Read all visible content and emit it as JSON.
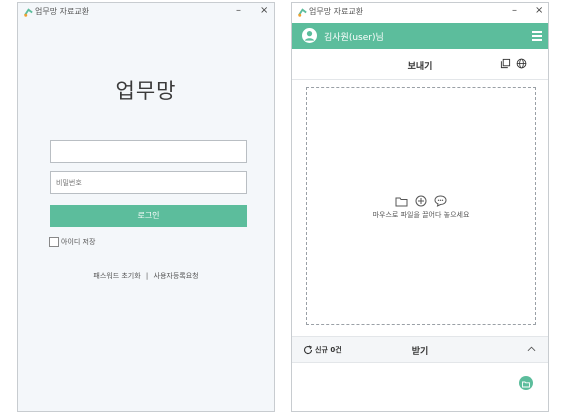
{
  "login_window": {
    "title": "업무망 자료교환",
    "min_glyph": "–",
    "close_glyph": "×",
    "app_name": "업무망",
    "id_input": {
      "value": "",
      "placeholder": ""
    },
    "password_input": {
      "value": "",
      "placeholder": "비밀번호"
    },
    "login_label": "로그인",
    "remember_label": "아이디 저장",
    "remember_checked": false,
    "reset_password_link": "패스워드 초기화",
    "link_separator": "|",
    "register_link": "사용자등록요청"
  },
  "main_window": {
    "title": "업무망 자료교환",
    "min_glyph": "–",
    "close_glyph": "×",
    "user_label": "김사원(user)님",
    "send_title": "보내기",
    "drop_hint": "마우스로 파일을 끌어다 놓으세요",
    "new_count": "신규 0건",
    "receive_title": "받기",
    "icons": [
      "user-icon",
      "menu-icon",
      "copy-icon",
      "globe-icon",
      "folder-icon",
      "add-icon",
      "comment-icon",
      "refresh-icon",
      "chevron-up-icon",
      "folder-open-icon"
    ]
  },
  "colors": {
    "accent": "#5cbd9c",
    "window_bg": "#f4f7fa",
    "border": "#c8ccd0"
  }
}
